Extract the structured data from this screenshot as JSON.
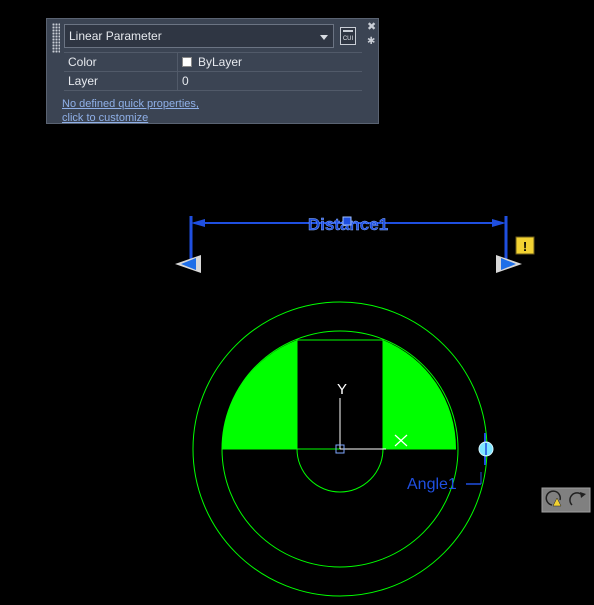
{
  "quick_properties": {
    "object_type": "Linear Parameter",
    "cui_label": "CUI",
    "rows": [
      {
        "label": "Color",
        "value": "ByLayer"
      },
      {
        "label": "Layer",
        "value": "0"
      }
    ],
    "link_line1": "No defined quick properties,",
    "link_line2": "click to customize"
  },
  "drawing": {
    "distance_label": "Distance1",
    "angle_label": "Angle1",
    "ucs_y_label": "Y",
    "warning_symbol": "!",
    "colors": {
      "parameter_blue": "#1f4fe0",
      "geometry_green": "#00ff00",
      "grip_cyan": "#7fe6ff",
      "warning_yellow": "#f2d232"
    }
  }
}
